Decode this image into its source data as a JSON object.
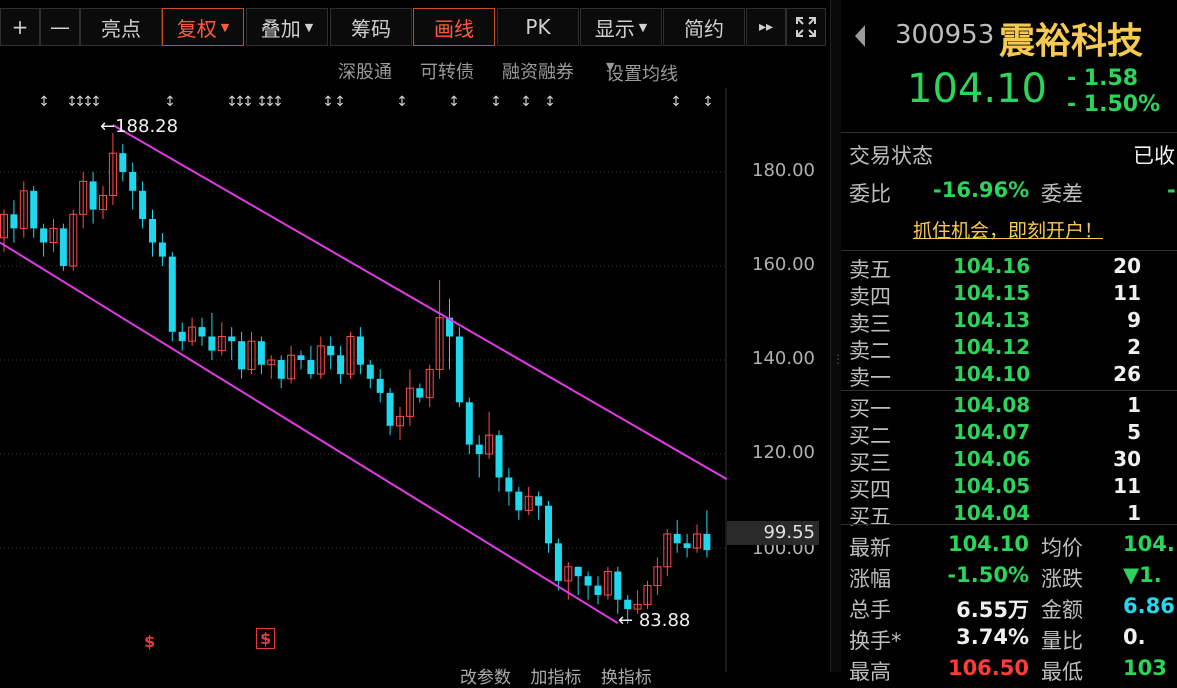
{
  "toolbar": {
    "plus": "+",
    "minus": "—",
    "liangdian": "亮点",
    "fuquan": "复权",
    "diejia": "叠加",
    "choumao": "筹码",
    "huaxian": "画线",
    "pk": "PK",
    "xianshi": "显示",
    "jianyue": "简约",
    "more": "▸▸",
    "fullscreen_icon": "expand-icon"
  },
  "subbar": {
    "shengutong": "深股通",
    "kezhuanzhai": "可转债",
    "rongzirongquan": "融资融券",
    "set_ma": "设置均线"
  },
  "chart": {
    "high_label": "188.28",
    "low_label": "83.88",
    "last_price_tag": "99.55",
    "y_ticks": [
      "180.00",
      "160.00",
      "140.00",
      "120.00",
      "100.00"
    ],
    "bottom_tabs": [
      "改参数",
      "加指标",
      "换指标"
    ]
  },
  "chart_data": {
    "type": "candlestick",
    "ylim": [
      80,
      200
    ],
    "y_ticks": [
      100,
      120,
      140,
      160,
      180
    ],
    "high": 188.28,
    "low": 83.88,
    "last": 99.55,
    "colors": {
      "up": "#ff4a4a",
      "down": "#20d8ee",
      "channel": "#e23be6"
    },
    "candles": [
      [
        166,
        171,
        163,
        172
      ],
      [
        171,
        168,
        165,
        174
      ],
      [
        168,
        176,
        166,
        178
      ],
      [
        176,
        168,
        166,
        177
      ],
      [
        168,
        165,
        162,
        169
      ],
      [
        165,
        168,
        163,
        170
      ],
      [
        168,
        160,
        159,
        169
      ],
      [
        160,
        171,
        159,
        172
      ],
      [
        171,
        178,
        168,
        180
      ],
      [
        178,
        172,
        169,
        180
      ],
      [
        172,
        175,
        170,
        177
      ],
      [
        175,
        184,
        173,
        188.28
      ],
      [
        184,
        180,
        178,
        186
      ],
      [
        180,
        176,
        172,
        182
      ],
      [
        176,
        170,
        168,
        178
      ],
      [
        170,
        165,
        162,
        172
      ],
      [
        165,
        162,
        160,
        167
      ],
      [
        162,
        146,
        144,
        163
      ],
      [
        146,
        144,
        142,
        148
      ],
      [
        144,
        147,
        143,
        149
      ],
      [
        147,
        145,
        143,
        149
      ],
      [
        145,
        142,
        140,
        150
      ],
      [
        142,
        145,
        141,
        148
      ],
      [
        145,
        144,
        140,
        147
      ],
      [
        144,
        138,
        136,
        146
      ],
      [
        138,
        144,
        137,
        146
      ],
      [
        144,
        139,
        137,
        145
      ],
      [
        139,
        140,
        136,
        141
      ],
      [
        140,
        136,
        134,
        141
      ],
      [
        136,
        141,
        135,
        143
      ],
      [
        141,
        140,
        138,
        142
      ],
      [
        140,
        137,
        136,
        143
      ],
      [
        137,
        143,
        136,
        145
      ],
      [
        143,
        141,
        138,
        145
      ],
      [
        141,
        137,
        135,
        143
      ],
      [
        137,
        145,
        136,
        146
      ],
      [
        145,
        139,
        137,
        147
      ],
      [
        139,
        136,
        134,
        140
      ],
      [
        136,
        133,
        131,
        138
      ],
      [
        133,
        126,
        124,
        134
      ],
      [
        126,
        128,
        123,
        130
      ],
      [
        128,
        134,
        126,
        138
      ],
      [
        134,
        132,
        131,
        135
      ],
      [
        132,
        138,
        130,
        139
      ],
      [
        138,
        149,
        136,
        157
      ],
      [
        149,
        145,
        138,
        153
      ],
      [
        145,
        131,
        130,
        147
      ],
      [
        131,
        122,
        120,
        132
      ],
      [
        122,
        120,
        115,
        124
      ],
      [
        120,
        124,
        119,
        129
      ],
      [
        124,
        115,
        112,
        125
      ],
      [
        115,
        112,
        109,
        117
      ],
      [
        112,
        108,
        106,
        113
      ],
      [
        108,
        111,
        107,
        113
      ],
      [
        111,
        109,
        106,
        112
      ],
      [
        109,
        101,
        99,
        110
      ],
      [
        101,
        93,
        91,
        102
      ],
      [
        93,
        96,
        89,
        97
      ],
      [
        96,
        94,
        90,
        96
      ],
      [
        94,
        92,
        89,
        95
      ],
      [
        92,
        90,
        88,
        94
      ],
      [
        90,
        95,
        89,
        96
      ],
      [
        95,
        89,
        86,
        96
      ],
      [
        89,
        87,
        83.88,
        90
      ],
      [
        87,
        88,
        86,
        91
      ],
      [
        88,
        92,
        87,
        93
      ],
      [
        92,
        96,
        90,
        98
      ],
      [
        96,
        103,
        94,
        104
      ],
      [
        103,
        101,
        99,
        106
      ],
      [
        101,
        100,
        98,
        103
      ],
      [
        100,
        103,
        99,
        105
      ],
      [
        103,
        99.55,
        98,
        108
      ]
    ],
    "channel_upper": [
      [
        11,
        190
      ],
      [
        71,
        114
      ]
    ],
    "channel_lower": [
      [
        0,
        165
      ],
      [
        62,
        84
      ]
    ]
  },
  "quote": {
    "code": "300953",
    "name": "震裕科技",
    "price": "104.10",
    "change": "- 1.58",
    "change_pct": "- 1.50%"
  },
  "status": {
    "trade_status_label": "交易状态",
    "trade_status_value": "已收",
    "weibi_label": "委比",
    "weibi_value": "-16.96%",
    "weicha_label": "委差",
    "weicha_value": "-",
    "promo": "抓住机会，即刻开户！"
  },
  "orderbook": {
    "asks": [
      {
        "label": "卖五",
        "price": "104.16",
        "vol": "20"
      },
      {
        "label": "卖四",
        "price": "104.15",
        "vol": "11"
      },
      {
        "label": "卖三",
        "price": "104.13",
        "vol": "9"
      },
      {
        "label": "卖二",
        "price": "104.12",
        "vol": "2"
      },
      {
        "label": "卖一",
        "price": "104.10",
        "vol": "26"
      }
    ],
    "bids": [
      {
        "label": "买一",
        "price": "104.08",
        "vol": "1"
      },
      {
        "label": "买二",
        "price": "104.07",
        "vol": "5"
      },
      {
        "label": "买三",
        "price": "104.06",
        "vol": "30"
      },
      {
        "label": "买四",
        "price": "104.05",
        "vol": "11"
      },
      {
        "label": "买五",
        "price": "104.04",
        "vol": "1"
      }
    ]
  },
  "stats": [
    {
      "l1": "最新",
      "v1": "104.10",
      "l2": "均价",
      "v2": "104."
    },
    {
      "l1": "涨幅",
      "v1": "-1.50%",
      "l2": "涨跌",
      "v2": "▼1."
    },
    {
      "l1": "总手",
      "v1": "6.55万",
      "l2": "金额",
      "v2": "6.86"
    },
    {
      "l1": "换手*",
      "v1": "3.74%",
      "l2": "量比",
      "v2": "0."
    },
    {
      "l1": "最高",
      "v1": "106.50",
      "l2": "最低",
      "v2": "103"
    }
  ]
}
